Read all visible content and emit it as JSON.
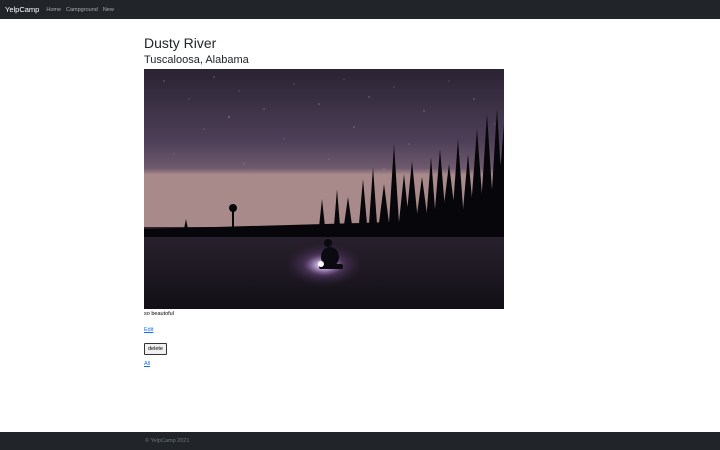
{
  "navbar": {
    "brand": "YelpCamp",
    "links": [
      "Home",
      "Campground",
      "New"
    ]
  },
  "campground": {
    "title": "Dusty River",
    "location": "Tuscaloosa, Alabama",
    "image_alt": "Night sky over a snowy clearing with pine tree silhouettes and a person sitting by a glowing lantern",
    "description": "so beautoful"
  },
  "actions": {
    "edit_label": "Edit",
    "delete_label": "delete",
    "all_label": "All"
  },
  "footer": {
    "text": "© YelpCamp 2021"
  },
  "colors": {
    "nav_bg": "#212529",
    "link": "#0d6efd",
    "footer_text": "#6c757d"
  }
}
